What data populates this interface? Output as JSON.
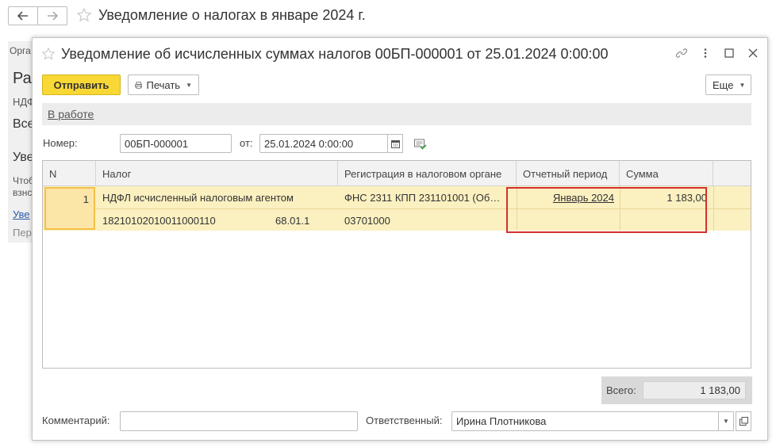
{
  "background": {
    "title": "Уведомление о налогах в январе 2024 г.",
    "fragments": {
      "org": "Орга",
      "heading": "Ра",
      "ndfl": "НДФ",
      "all": "Все",
      "notif": "Уве",
      "line1": "Чтоб",
      "line2": "взнс",
      "link": "Уве",
      "per": "Пер"
    }
  },
  "modal": {
    "title": "Уведомление об исчисленных суммах налогов 00БП-000001 от 25.01.2024 0:00:00",
    "toolbar": {
      "send_label": "Отправить",
      "print_label": "Печать",
      "more_label": "Еще"
    },
    "status": "В работе",
    "number_label": "Номер:",
    "number_value": "00БП-000001",
    "date_label": "от:",
    "date_value": "25.01.2024  0:00:00",
    "table": {
      "columns": [
        "N",
        "Налог",
        "Регистрация в налоговом органе",
        "Отчетный период",
        "Сумма"
      ],
      "rows": [
        {
          "n": "1",
          "tax": "НДФЛ исчисленный налоговым агентом",
          "kbk": "18210102010011000110",
          "account": "68.01.1",
          "registration": "ФНС 2311 КПП 231101001 (Об…",
          "oktmo": "03701000",
          "period": "Январь 2024",
          "sum": "1 183,00"
        }
      ]
    },
    "total_label": "Всего:",
    "total_value": "1 183,00",
    "comment_label": "Комментарий:",
    "comment_value": "",
    "responsible_label": "Ответственный:",
    "responsible_value": "Ирина Плотникова"
  }
}
